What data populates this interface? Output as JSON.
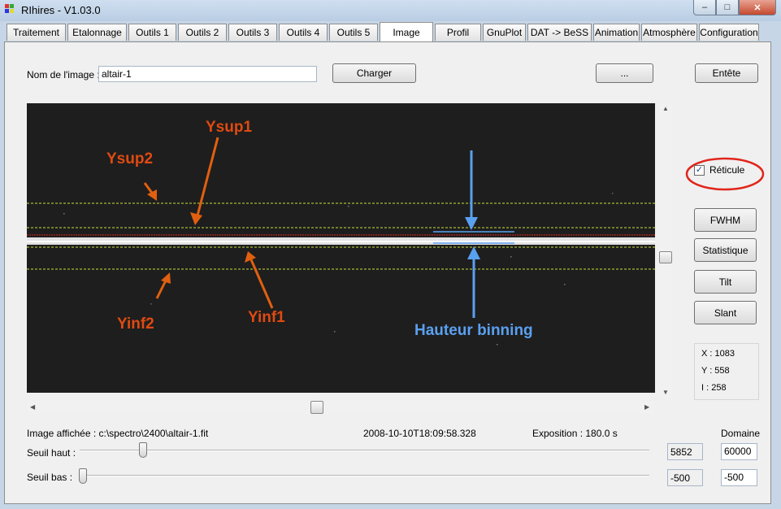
{
  "window": {
    "title": "RIhires - V1.03.0",
    "min_symbol": "–",
    "max_symbol": "□",
    "close_symbol": "✕"
  },
  "tabs": [
    {
      "label": "Traitement"
    },
    {
      "label": "Etalonnage"
    },
    {
      "label": "Outils 1"
    },
    {
      "label": "Outils 2"
    },
    {
      "label": "Outils 3"
    },
    {
      "label": "Outils 4"
    },
    {
      "label": "Outils 5"
    },
    {
      "label": "Image",
      "active": true
    },
    {
      "label": "Profil"
    },
    {
      "label": "GnuPlot"
    },
    {
      "label": "DAT -> BeSS"
    },
    {
      "label": "Animation"
    },
    {
      "label": "Atmosphère"
    },
    {
      "label": "Configuration"
    }
  ],
  "image_panel": {
    "name_label": "Nom de l'image :",
    "name_value": "altair-1",
    "load_button": "Charger",
    "browse_button": "...",
    "header_button": "Entête",
    "reticle_label": "Réticule",
    "reticle_checked": true,
    "reticle_check_symbol": "✓",
    "buttons": {
      "fwhm": "FWHM",
      "stats": "Statistique",
      "tilt": "Tilt",
      "slant": "Slant"
    },
    "coords": {
      "x": "X : 1083",
      "y": "Y : 558",
      "i": "I  : 258"
    },
    "annotations": {
      "ysup1": "Ysup1",
      "ysup2": "Ysup2",
      "yinf1": "Yinf1",
      "yinf2": "Yinf2",
      "binning": "Hauteur binning"
    },
    "status": {
      "displayed_image": "Image affichée : c:\\spectro\\2400\\altair-1.fit",
      "timestamp": "2008-10-10T18:09:58.328",
      "exposure": "Exposition : 180.0 s"
    },
    "domain_label": "Domaine",
    "seuil_haut": {
      "label": "Seuil haut :",
      "value": "5852",
      "domain": "60000"
    },
    "seuil_bas": {
      "label": "Seuil bas :",
      "value": "-500",
      "domain": "-500"
    }
  },
  "colors": {
    "annotation_red": "#e04a10",
    "annotation_orange": "#e06010",
    "annotation_blue": "#5aa0f0",
    "reticle_yellow": "#c9dd3b",
    "highlight_circle": "#e0261c"
  }
}
